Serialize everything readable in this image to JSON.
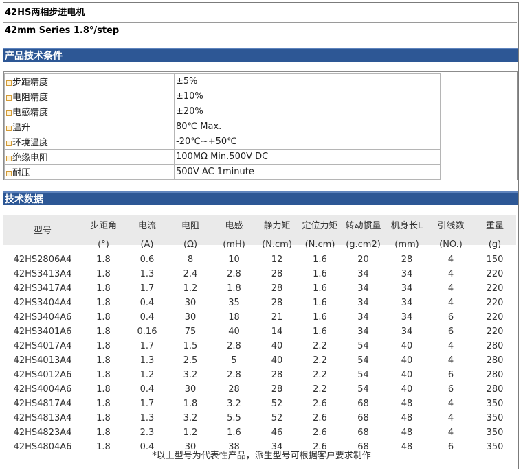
{
  "title": "42HS两相步进电机",
  "subtitle": "42mm Series 1.8°/step",
  "spec_section_title": "产品技术条件",
  "specs": [
    {
      "label": "步距精度",
      "value": "±5%"
    },
    {
      "label": "电阻精度",
      "value": "±10%"
    },
    {
      "label": "电感精度",
      "value": "±20%"
    },
    {
      "label": "温升",
      "value": "80℃ Max."
    },
    {
      "label": "环境温度",
      "value": "-20℃~+50℃"
    },
    {
      "label": "绝缘电阻",
      "value": "100MΩ Min.500V DC"
    },
    {
      "label": "耐压",
      "value": "500V AC 1minute"
    }
  ],
  "data_section_title": "技术数据",
  "headers": [
    {
      "name": "型号",
      "unit": ""
    },
    {
      "name": "步距角",
      "unit": "(°)"
    },
    {
      "name": "电流",
      "unit": "(A)"
    },
    {
      "name": "电阻",
      "unit": "(Ω)"
    },
    {
      "name": "电感",
      "unit": "(mH)"
    },
    {
      "name": "静力矩",
      "unit": "(N.cm)"
    },
    {
      "name": "定位力矩",
      "unit": "(N.cm)"
    },
    {
      "name": "转动惯量",
      "unit": "(g.cm2)"
    },
    {
      "name": "机身长L",
      "unit": "(mm)"
    },
    {
      "name": "引线数",
      "unit": "(NO.)"
    },
    {
      "name": "重量",
      "unit": "(g)"
    }
  ],
  "rows": [
    [
      "42HS2806A4",
      "1.8",
      "0.6",
      "8",
      "10",
      "12",
      "1.6",
      "20",
      "28",
      "4",
      "150"
    ],
    [
      "42HS3413A4",
      "1.8",
      "1.3",
      "2.4",
      "2.8",
      "28",
      "1.6",
      "34",
      "34",
      "4",
      "220"
    ],
    [
      "42HS3417A4",
      "1.8",
      "1.7",
      "1.2",
      "1.8",
      "28",
      "1.6",
      "34",
      "34",
      "4",
      "220"
    ],
    [
      "42HS3404A4",
      "1.8",
      "0.4",
      "30",
      "35",
      "28",
      "1.6",
      "34",
      "34",
      "4",
      "220"
    ],
    [
      "42HS3404A6",
      "1.8",
      "0.4",
      "30",
      "18",
      "21",
      "1.6",
      "34",
      "34",
      "6",
      "220"
    ],
    [
      "42HS3401A6",
      "1.8",
      "0.16",
      "75",
      "40",
      "14",
      "1.6",
      "34",
      "34",
      "6",
      "220"
    ],
    [
      "42HS4017A4",
      "1.8",
      "1.7",
      "1.5",
      "2.8",
      "40",
      "2.2",
      "54",
      "40",
      "4",
      "280"
    ],
    [
      "42HS4013A4",
      "1.8",
      "1.3",
      "2.5",
      "5",
      "40",
      "2.2",
      "54",
      "40",
      "4",
      "280"
    ],
    [
      "42HS4012A6",
      "1.8",
      "1.2",
      "3.2",
      "2.8",
      "28",
      "2.2",
      "54",
      "40",
      "6",
      "280"
    ],
    [
      "42HS4004A6",
      "1.8",
      "0.4",
      "30",
      "28",
      "28",
      "2.2",
      "54",
      "40",
      "6",
      "280"
    ],
    [
      "42HS4817A4",
      "1.8",
      "1.7",
      "1.8",
      "3.2",
      "52",
      "2.6",
      "68",
      "48",
      "4",
      "350"
    ],
    [
      "42HS4813A4",
      "1.8",
      "1.3",
      "3.2",
      "5.5",
      "52",
      "2.6",
      "68",
      "48",
      "4",
      "350"
    ],
    [
      "42HS4823A4",
      "1.8",
      "2.3",
      "1.2",
      "1.6",
      "46",
      "2.6",
      "68",
      "48",
      "4",
      "350"
    ],
    [
      "42HS4804A6",
      "1.8",
      "0.4",
      "30",
      "38",
      "34",
      "2.6",
      "68",
      "48",
      "6",
      "350"
    ]
  ],
  "footnote": "*以上型号为代表性产品，派生型号可根据客户要求制作",
  "colors": {
    "section_bar": "#2d5795",
    "header_bg": "#eaeaea",
    "bullet": "#d29a36"
  }
}
